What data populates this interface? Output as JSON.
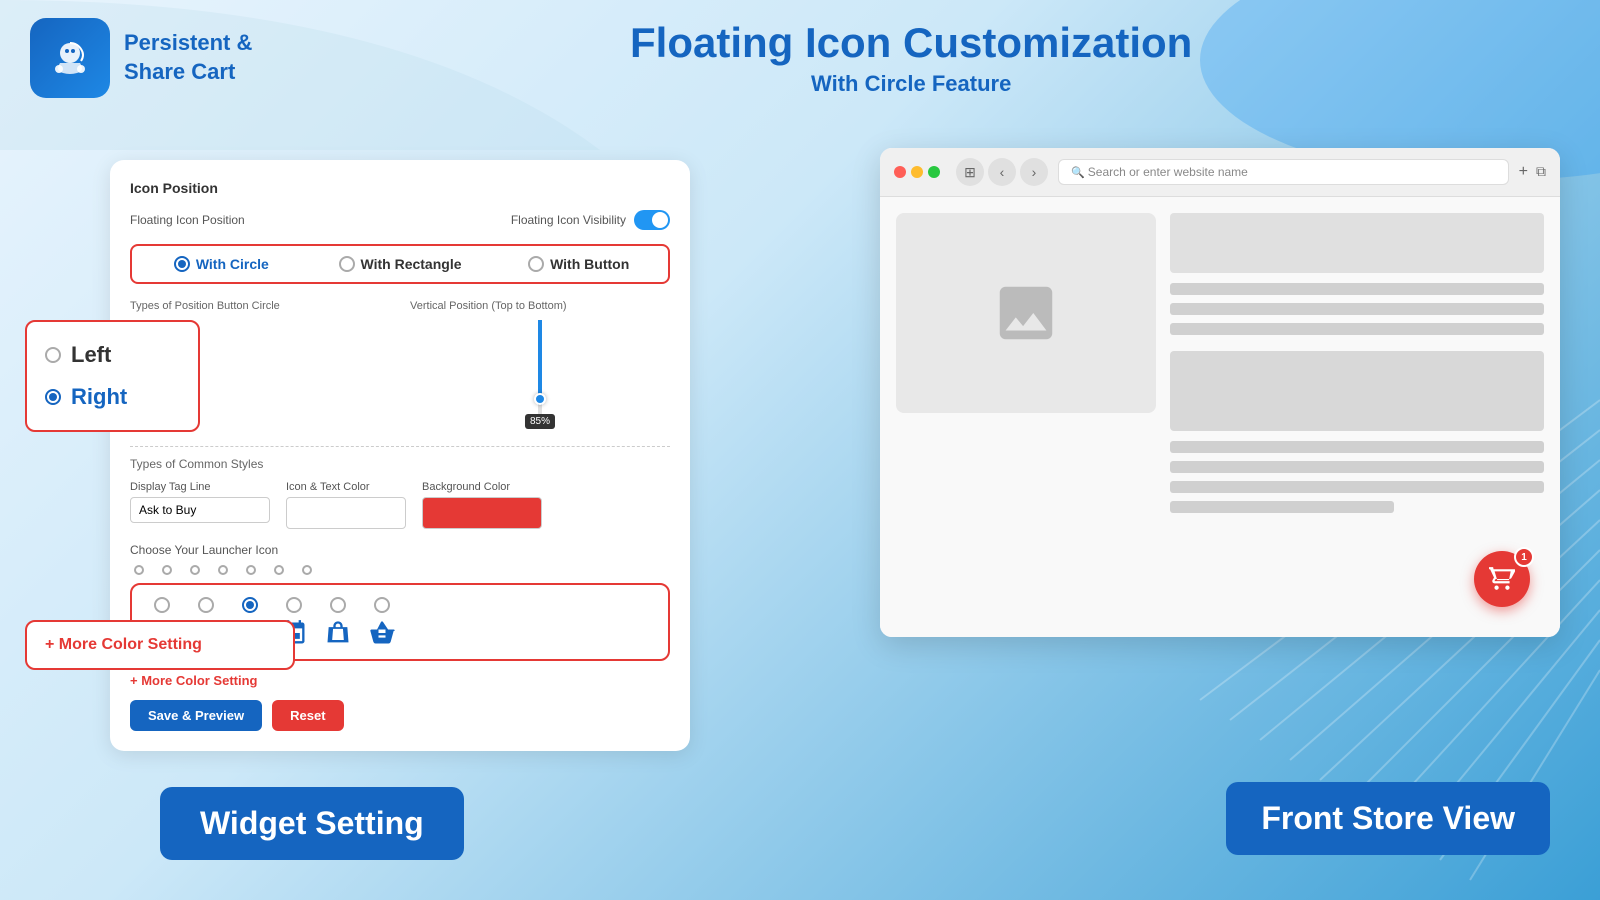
{
  "header": {
    "brand_line1": "Persistent &",
    "brand_line2": "Share Cart",
    "title": "Floating Icon Customization",
    "subtitle": "With Circle Feature"
  },
  "settings": {
    "card_title": "Icon Position",
    "floating_position_label": "Floating Icon Position",
    "floating_visibility_label": "Floating Icon Visibility",
    "shape_options": [
      {
        "id": "circle",
        "label": "With Circle",
        "active": true
      },
      {
        "id": "rectangle",
        "label": "With Rectangle",
        "active": false
      },
      {
        "id": "button",
        "label": "With Button",
        "active": false
      }
    ],
    "position_type_label": "Types of Position Button Circle",
    "vertical_position_label": "Vertical Position (Top to Bottom)",
    "slider_value": "85%",
    "left_label": "Left",
    "right_label": "Right",
    "common_styles_label": "Types of Common Styles",
    "display_tag_label": "Display Tag Line",
    "display_tag_value": "Ask to Buy",
    "icon_text_color_label": "Icon & Text Color",
    "bg_color_label": "Background Color",
    "launcher_label": "Choose Your Launcher Icon",
    "more_color_label": "+ More Color Setting",
    "save_preview_label": "Save & Preview",
    "reset_label": "Reset"
  },
  "more_color_box": {
    "text": "+ More Color Setting"
  },
  "browser": {
    "address_placeholder": "Search or enter website name",
    "cart_badge_count": "1"
  },
  "labels": {
    "front_store_view": "Front Store View",
    "widget_setting": "Widget Setting"
  }
}
